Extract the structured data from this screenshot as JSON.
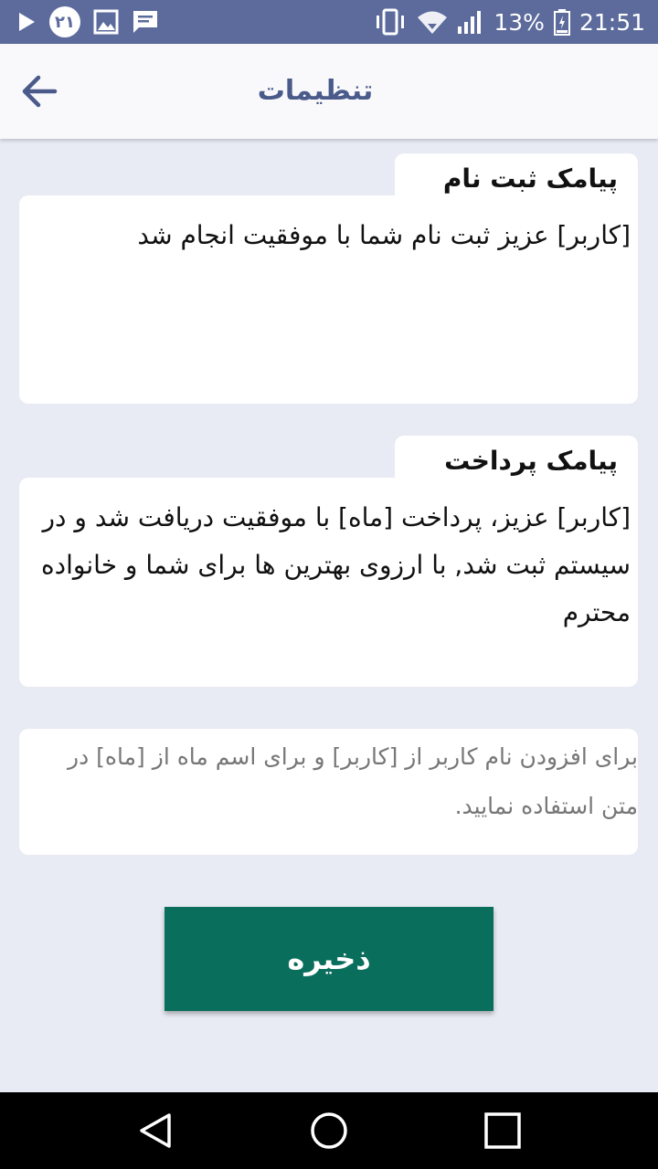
{
  "status_bar": {
    "badge": "۲۱",
    "battery": "13%",
    "time": "21:51",
    "icons": [
      "play-icon",
      "badge-icon",
      "image-icon",
      "message-icon",
      "vibrate-icon",
      "wifi-icon",
      "signal-icon",
      "battery-icon"
    ]
  },
  "app_bar": {
    "title": "تنظیمات",
    "back_icon": "arrow-back-icon"
  },
  "registration": {
    "label": "پیامک ثبت نام",
    "text": "[کاربر] عزیز ثبت نام شما با موفقیت انجام شد"
  },
  "payment": {
    "label": "پیامک پرداخت",
    "text": "[کاربر] عزیز، پرداخت [ماه] با موفقیت دریافت شد و در سیستم ثبت شد, با ارزوی بهترین ها برای شما و خانواده محترم"
  },
  "hint": {
    "text": "برای افزودن نام کاربر از [کاربر] و برای اسم ماه از [ماه] در متن استفاده نمایید."
  },
  "save_button": {
    "label": "ذخیره"
  },
  "colors": {
    "status_bar": "#5c6b9c",
    "title": "#4a5a8a",
    "save_button": "#0a6e5d",
    "background": "#e8eaf4"
  }
}
